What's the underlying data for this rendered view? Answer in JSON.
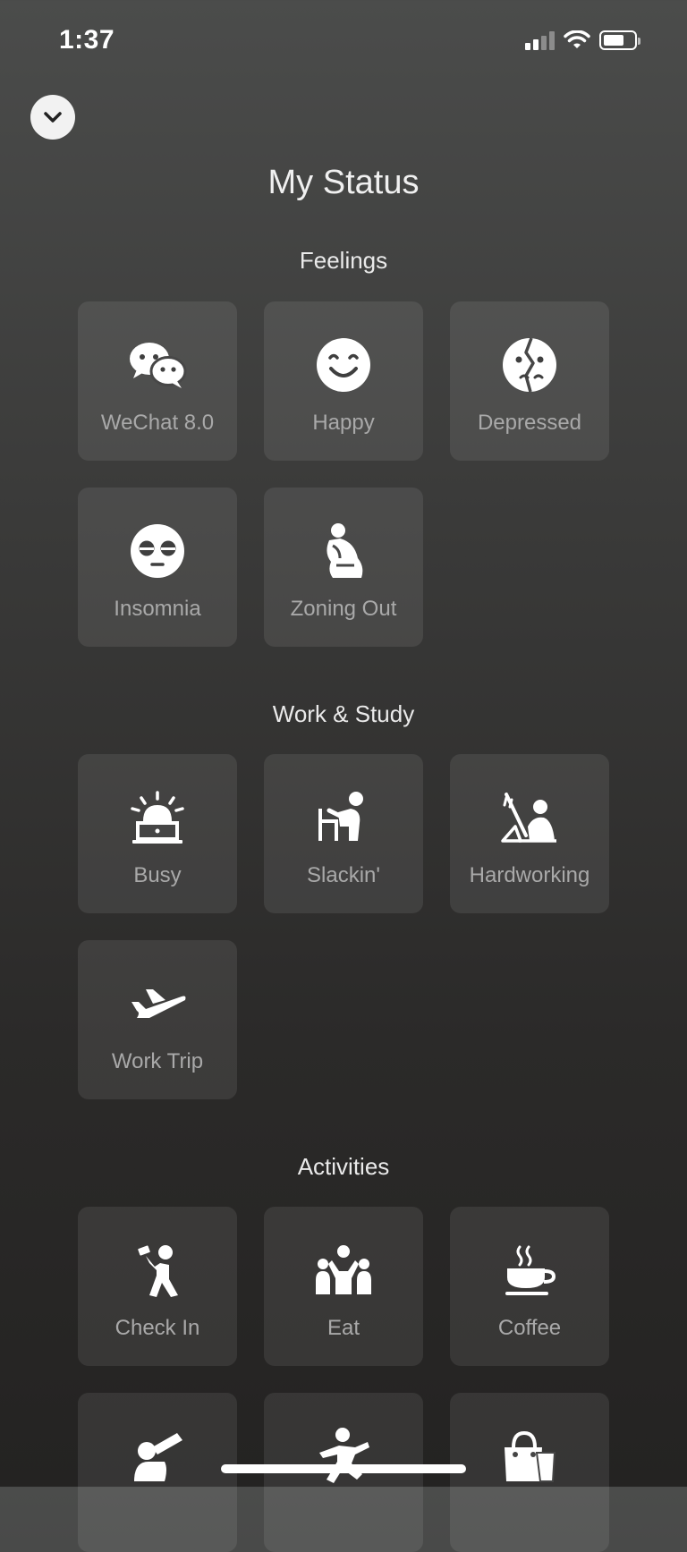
{
  "status_bar": {
    "time": "1:37"
  },
  "title": "My Status",
  "sections": [
    {
      "title": "Feelings",
      "items": [
        {
          "label": "WeChat 8.0",
          "icon": "wechat-icon"
        },
        {
          "label": "Happy",
          "icon": "smiley-icon"
        },
        {
          "label": "Depressed",
          "icon": "cracked-face-icon"
        },
        {
          "label": "Insomnia",
          "icon": "tired-face-icon"
        },
        {
          "label": "Zoning Out",
          "icon": "thinker-icon"
        }
      ]
    },
    {
      "title": "Work & Study",
      "items": [
        {
          "label": "Busy",
          "icon": "alarm-laptop-icon"
        },
        {
          "label": "Slackin'",
          "icon": "slacking-desk-icon"
        },
        {
          "label": "Hardworking",
          "icon": "hardworking-desk-icon"
        },
        {
          "label": "Work Trip",
          "icon": "airplane-icon"
        }
      ]
    },
    {
      "title": "Activities",
      "items": [
        {
          "label": "Check In",
          "icon": "selfie-person-icon"
        },
        {
          "label": "Eat",
          "icon": "group-eating-icon"
        },
        {
          "label": "Coffee",
          "icon": "coffee-cup-icon"
        },
        {
          "label": "",
          "icon": "drinking-icon"
        },
        {
          "label": "",
          "icon": "running-icon"
        },
        {
          "label": "",
          "icon": "shopping-bag-icon"
        }
      ]
    }
  ]
}
